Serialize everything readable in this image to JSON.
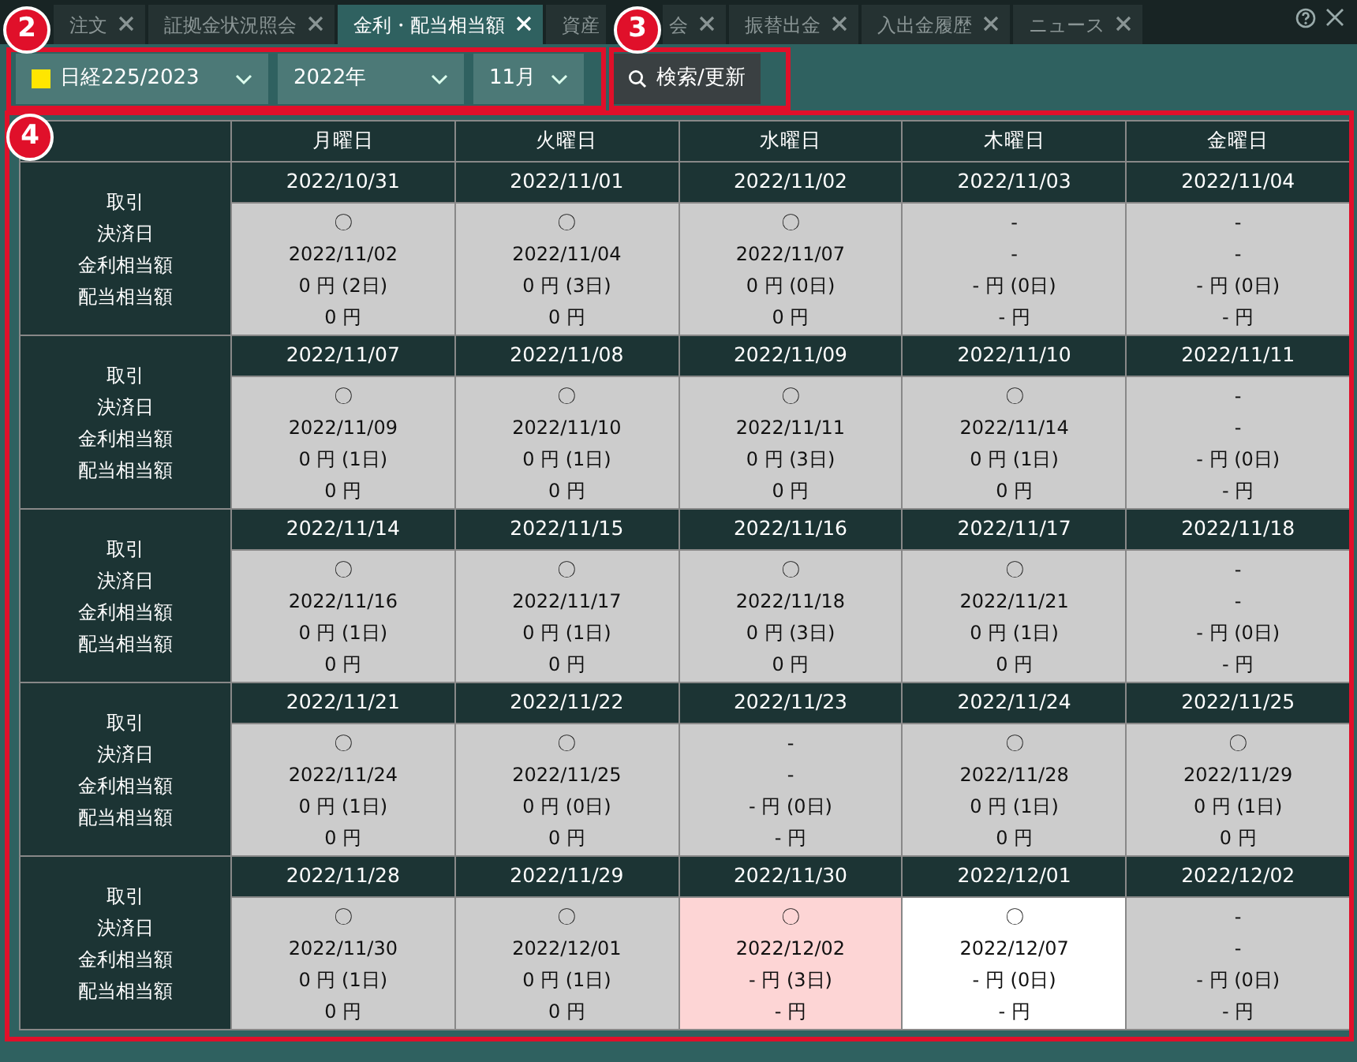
{
  "tabs": [
    {
      "label": "注文",
      "selected": false
    },
    {
      "label": "証拠金状況照会",
      "selected": false
    },
    {
      "label": "金利・配当相当額",
      "selected": true
    },
    {
      "label": "資産",
      "label_tail": "会",
      "selected": false
    },
    {
      "label": "振替出金",
      "selected": false
    },
    {
      "label": "入出金履歴",
      "selected": false
    },
    {
      "label": "ニュース",
      "selected": false
    }
  ],
  "filters": [
    {
      "value": "日経225/2023",
      "color": "#ffe600"
    },
    {
      "value": "2022年"
    },
    {
      "value": "11月"
    }
  ],
  "search_button": "検索/更新",
  "weekdays": [
    "月曜日",
    "火曜日",
    "水曜日",
    "木曜日",
    "金曜日"
  ],
  "weeks": [
    {
      "labels": [
        "取引",
        "決済日",
        "金利相当額",
        "配当相当額"
      ],
      "days": [
        {
          "date": "2022/10/31",
          "trade": "〇",
          "settle": "2022/11/02",
          "interest": "0 円 (2日)",
          "dividend": "0 円",
          "color": "#cccccc"
        },
        {
          "date": "2022/11/01",
          "trade": "〇",
          "settle": "2022/11/04",
          "interest": "0 円 (3日)",
          "dividend": "0 円",
          "color": "#cccccc"
        },
        {
          "date": "2022/11/02",
          "trade": "〇",
          "settle": "2022/11/07",
          "interest": "0 円 (0日)",
          "dividend": "0 円",
          "color": "#cccccc"
        },
        {
          "date": "2022/11/03",
          "trade": "-",
          "settle": "-",
          "interest": "- 円 (0日)",
          "dividend": "- 円",
          "color": "#cccccc"
        },
        {
          "date": "2022/11/04",
          "trade": "-",
          "settle": "-",
          "interest": "- 円 (0日)",
          "dividend": "- 円",
          "color": "#cccccc"
        }
      ]
    },
    {
      "labels": [
        "取引",
        "決済日",
        "金利相当額",
        "配当相当額"
      ],
      "days": [
        {
          "date": "2022/11/07",
          "trade": "〇",
          "settle": "2022/11/09",
          "interest": "0 円 (1日)",
          "dividend": "0 円",
          "color": "#cccccc"
        },
        {
          "date": "2022/11/08",
          "trade": "〇",
          "settle": "2022/11/10",
          "interest": "0 円 (1日)",
          "dividend": "0 円",
          "color": "#cccccc"
        },
        {
          "date": "2022/11/09",
          "trade": "〇",
          "settle": "2022/11/11",
          "interest": "0 円 (3日)",
          "dividend": "0 円",
          "color": "#cccccc"
        },
        {
          "date": "2022/11/10",
          "trade": "〇",
          "settle": "2022/11/14",
          "interest": "0 円 (1日)",
          "dividend": "0 円",
          "color": "#cccccc"
        },
        {
          "date": "2022/11/11",
          "trade": "-",
          "settle": "-",
          "interest": "- 円 (0日)",
          "dividend": "- 円",
          "color": "#cccccc"
        }
      ]
    },
    {
      "labels": [
        "取引",
        "決済日",
        "金利相当額",
        "配当相当額"
      ],
      "days": [
        {
          "date": "2022/11/14",
          "trade": "〇",
          "settle": "2022/11/16",
          "interest": "0 円 (1日)",
          "dividend": "0 円",
          "color": "#cccccc"
        },
        {
          "date": "2022/11/15",
          "trade": "〇",
          "settle": "2022/11/17",
          "interest": "0 円 (1日)",
          "dividend": "0 円",
          "color": "#cccccc"
        },
        {
          "date": "2022/11/16",
          "trade": "〇",
          "settle": "2022/11/18",
          "interest": "0 円 (3日)",
          "dividend": "0 円",
          "color": "#cccccc"
        },
        {
          "date": "2022/11/17",
          "trade": "〇",
          "settle": "2022/11/21",
          "interest": "0 円 (1日)",
          "dividend": "0 円",
          "color": "#cccccc"
        },
        {
          "date": "2022/11/18",
          "trade": "-",
          "settle": "-",
          "interest": "- 円 (0日)",
          "dividend": "- 円",
          "color": "#cccccc"
        }
      ]
    },
    {
      "labels": [
        "取引",
        "決済日",
        "金利相当額",
        "配当相当額"
      ],
      "days": [
        {
          "date": "2022/11/21",
          "trade": "〇",
          "settle": "2022/11/24",
          "interest": "0 円 (1日)",
          "dividend": "0 円",
          "color": "#cccccc"
        },
        {
          "date": "2022/11/22",
          "trade": "〇",
          "settle": "2022/11/25",
          "interest": "0 円 (0日)",
          "dividend": "0 円",
          "color": "#cccccc"
        },
        {
          "date": "2022/11/23",
          "trade": "-",
          "settle": "-",
          "interest": "- 円 (0日)",
          "dividend": "- 円",
          "color": "#cccccc"
        },
        {
          "date": "2022/11/24",
          "trade": "〇",
          "settle": "2022/11/28",
          "interest": "0 円 (1日)",
          "dividend": "0 円",
          "color": "#cccccc"
        },
        {
          "date": "2022/11/25",
          "trade": "〇",
          "settle": "2022/11/29",
          "interest": "0 円 (1日)",
          "dividend": "0 円",
          "color": "#cccccc"
        }
      ]
    },
    {
      "labels": [
        "取引",
        "決済日",
        "金利相当額",
        "配当相当額"
      ],
      "days": [
        {
          "date": "2022/11/28",
          "trade": "〇",
          "settle": "2022/11/30",
          "interest": "0 円 (1日)",
          "dividend": "0 円",
          "color": "#cccccc"
        },
        {
          "date": "2022/11/29",
          "trade": "〇",
          "settle": "2022/12/01",
          "interest": "0 円 (1日)",
          "dividend": "0 円",
          "color": "#cccccc"
        },
        {
          "date": "2022/11/30",
          "trade": "〇",
          "settle": "2022/12/02",
          "interest": "- 円 (3日)",
          "dividend": "- 円",
          "color": "#fdd5d5"
        },
        {
          "date": "2022/12/01",
          "trade": "〇",
          "settle": "2022/12/07",
          "interest": "- 円 (0日)",
          "dividend": "- 円",
          "color": "#ffffff"
        },
        {
          "date": "2022/12/02",
          "trade": "-",
          "settle": "-",
          "interest": "- 円 (0日)",
          "dividend": "- 円",
          "color": "#cccccc"
        }
      ]
    }
  ],
  "callouts": [
    {
      "number": "2"
    },
    {
      "number": "3"
    },
    {
      "number": "4"
    }
  ]
}
